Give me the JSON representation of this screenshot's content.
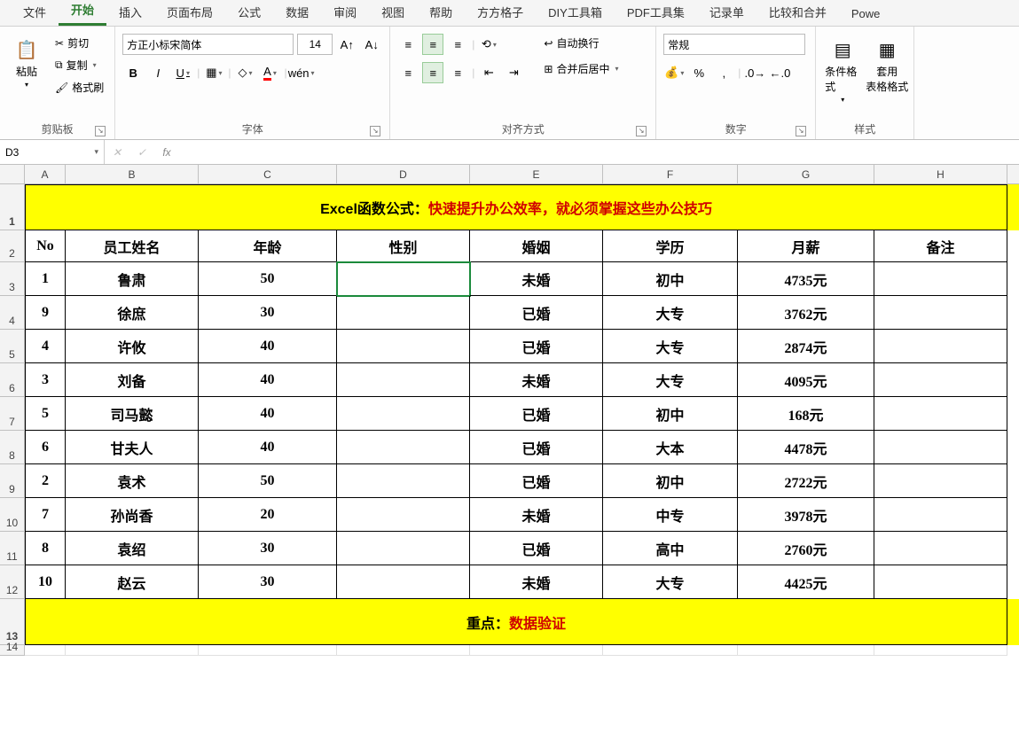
{
  "tabs": [
    "文件",
    "开始",
    "插入",
    "页面布局",
    "公式",
    "数据",
    "审阅",
    "视图",
    "帮助",
    "方方格子",
    "DIY工具箱",
    "PDF工具集",
    "记录单",
    "比较和合并",
    "Powe"
  ],
  "active_tab": "开始",
  "ribbon": {
    "clipboard": {
      "paste": "粘贴",
      "cut": "剪切",
      "copy": "复制",
      "format_painter": "格式刷",
      "label": "剪贴板"
    },
    "font": {
      "name": "方正小标宋简体",
      "size": "14",
      "bold": "B",
      "italic": "I",
      "underline": "U",
      "label": "字体"
    },
    "align": {
      "wrap": "自动换行",
      "merge": "合并后居中",
      "label": "对齐方式"
    },
    "number": {
      "format": "常规",
      "label": "数字"
    },
    "styles": {
      "cond": "条件格式",
      "table": "套用\n表格格式",
      "label": "样式"
    }
  },
  "namebox": "D3",
  "formula": "",
  "columns": [
    "A",
    "B",
    "C",
    "D",
    "E",
    "F",
    "G",
    "H"
  ],
  "title": {
    "pre": "Excel函数公式：",
    "msg": "快速提升办公效率，就必须掌握这些办公技巧"
  },
  "headers": [
    "No",
    "员工姓名",
    "年龄",
    "性别",
    "婚姻",
    "学历",
    "月薪",
    "备注"
  ],
  "data": [
    {
      "no": "1",
      "name": "鲁肃",
      "age": "50",
      "sex": "",
      "mar": "未婚",
      "edu": "初中",
      "sal": "4735元",
      "note": ""
    },
    {
      "no": "9",
      "name": "徐庶",
      "age": "30",
      "sex": "",
      "mar": "已婚",
      "edu": "大专",
      "sal": "3762元",
      "note": ""
    },
    {
      "no": "4",
      "name": "许攸",
      "age": "40",
      "sex": "",
      "mar": "已婚",
      "edu": "大专",
      "sal": "2874元",
      "note": ""
    },
    {
      "no": "3",
      "name": "刘备",
      "age": "40",
      "sex": "",
      "mar": "未婚",
      "edu": "大专",
      "sal": "4095元",
      "note": ""
    },
    {
      "no": "5",
      "name": "司马懿",
      "age": "40",
      "sex": "",
      "mar": "已婚",
      "edu": "初中",
      "sal": "168元",
      "note": ""
    },
    {
      "no": "6",
      "name": "甘夫人",
      "age": "40",
      "sex": "",
      "mar": "已婚",
      "edu": "大本",
      "sal": "4478元",
      "note": ""
    },
    {
      "no": "2",
      "name": "袁术",
      "age": "50",
      "sex": "",
      "mar": "已婚",
      "edu": "初中",
      "sal": "2722元",
      "note": ""
    },
    {
      "no": "7",
      "name": "孙尚香",
      "age": "20",
      "sex": "",
      "mar": "未婚",
      "edu": "中专",
      "sal": "3978元",
      "note": ""
    },
    {
      "no": "8",
      "name": "袁绍",
      "age": "30",
      "sex": "",
      "mar": "已婚",
      "edu": "高中",
      "sal": "2760元",
      "note": ""
    },
    {
      "no": "10",
      "name": "赵云",
      "age": "30",
      "sex": "",
      "mar": "未婚",
      "edu": "大专",
      "sal": "4425元",
      "note": ""
    }
  ],
  "footer": {
    "pre": "重点：",
    "msg": "数据验证"
  },
  "selected_cell": "D3"
}
